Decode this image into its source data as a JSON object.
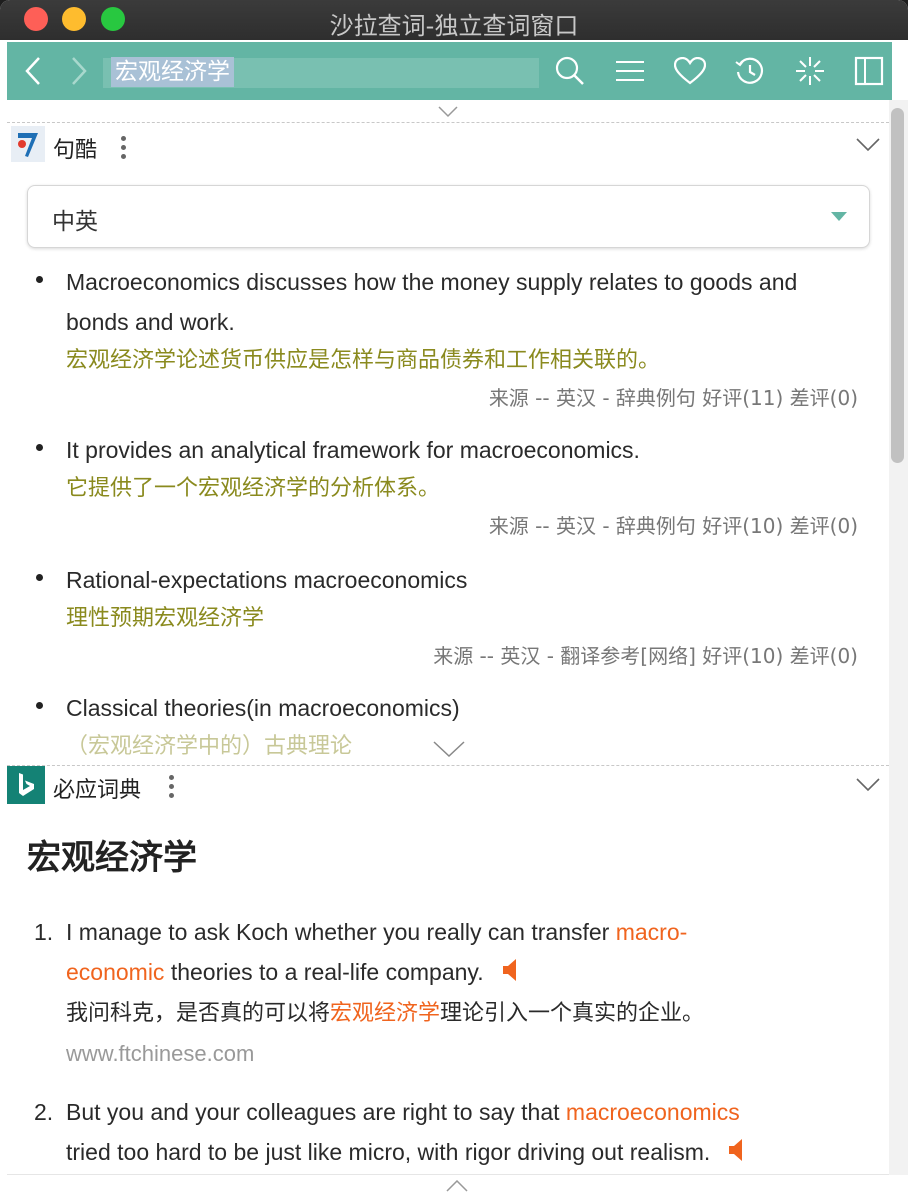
{
  "window": {
    "title": "沙拉查词-独立查词窗口"
  },
  "toolbar": {
    "search_value": "宏观经济学",
    "icons": [
      "back-icon",
      "forward-icon",
      "search-icon",
      "menu-icon",
      "heart-icon",
      "history-icon",
      "sparkle-icon",
      "sidebar-icon"
    ]
  },
  "colors": {
    "accent": "#63b5a4",
    "chinese_text": "#8a8a1e",
    "highlight": "#f0641e"
  },
  "jukuu": {
    "name": "句酷",
    "select_value": "中英",
    "examples": [
      {
        "en": "Macroeconomics discusses how the money supply relates to goods and bonds and work.",
        "zh": "宏观经济学论述货币供应是怎样与商品债券和工作相关联的。",
        "src": "来源 -- 英汉 - 辞典例句 好评(11) 差评(0)"
      },
      {
        "en": "It provides an analytical framework for macroeconomics.",
        "zh": "它提供了一个宏观经济学的分析体系。",
        "src": "来源 -- 英汉 - 辞典例句 好评(10) 差评(0)"
      },
      {
        "en": "Rational-expectations macroeconomics",
        "zh": "理性预期宏观经济学",
        "src": "来源 -- 英汉 - 翻译参考[网络] 好评(10) 差评(0)"
      },
      {
        "en": "Classical theories(in macroeconomics)",
        "zh": "（宏观经济学中的）古典理论"
      }
    ]
  },
  "bing": {
    "name": "必应词典",
    "headword": "宏观经济学",
    "items": [
      {
        "num": "1.",
        "en_pre": "I manage to ask Koch whether you really can transfer ",
        "en_hl": "macro-",
        "en_hl2": "economic",
        "en_post": " theories to a real-life company.",
        "zh_pre": "我问科克，是否真的可以将",
        "zh_hl": "宏观经济学",
        "zh_post": "理论引入一个真实的企业。",
        "src": "www.ftchinese.com"
      },
      {
        "num": "2.",
        "en_pre": "But you and your colleagues are right to say that ",
        "en_hl": "macroeconomics",
        "en_post": "tried too hard to be just like micro, with rigor driving out realism."
      }
    ]
  }
}
